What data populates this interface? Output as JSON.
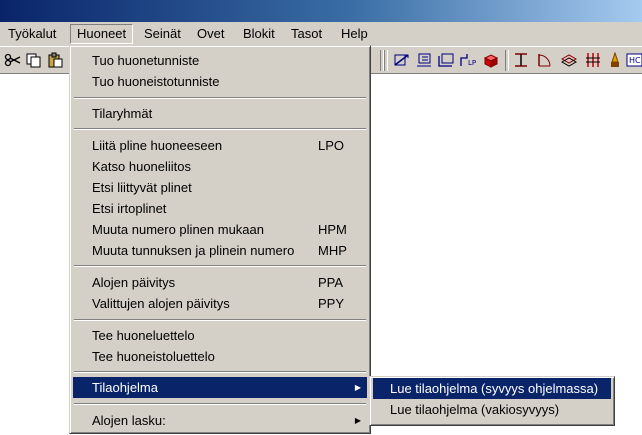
{
  "menubar": {
    "items": [
      "Työkalut",
      "Huoneet",
      "Seinät",
      "Ovet",
      "Blokit",
      "Tasot",
      "Help"
    ],
    "open_menu": "Huoneet"
  },
  "toolbar": {
    "left_icons": [
      "scissors-icon",
      "copy-icon",
      "paste-icon"
    ],
    "right_icons": [
      "dimension-icon",
      "room-tag-icon",
      "room-area-icon",
      "pline-icon",
      "3d-box-icon",
      "beam-icon",
      "door-icon",
      "layer-icon",
      "wall-hatch-icon",
      "pen-icon",
      "room-id-icon"
    ]
  },
  "colors": {
    "menu_bg": "#d4d0c8",
    "highlight": "#0a246a",
    "highlight_text": "#ffffff",
    "title_bar": "#0a246a"
  },
  "dropdown": {
    "items": [
      {
        "label": "Tuo huonetunniste",
        "shortcut": ""
      },
      {
        "label": "Tuo huoneistotunniste",
        "shortcut": ""
      },
      {
        "label": "Tilaryhmät",
        "shortcut": ""
      },
      {
        "label": "Liitä pline huoneeseen",
        "shortcut": "LPO"
      },
      {
        "label": "Katso huoneliitos",
        "shortcut": ""
      },
      {
        "label": "Etsi liittyvät plinet",
        "shortcut": ""
      },
      {
        "label": "Etsi irtoplinet",
        "shortcut": ""
      },
      {
        "label": "Muuta numero plinen mukaan",
        "shortcut": "HPM"
      },
      {
        "label": "Muuta tunnuksen ja plinein numero",
        "shortcut": "MHP"
      },
      {
        "label": "Alojen päivitys",
        "shortcut": "PPA"
      },
      {
        "label": "Valittujen alojen päivitys",
        "shortcut": "PPY"
      },
      {
        "label": "Tee huoneluettelo",
        "shortcut": ""
      },
      {
        "label": "Tee huoneistoluettelo",
        "shortcut": ""
      },
      {
        "label": "Tilaohjelma",
        "shortcut": ""
      },
      {
        "label": "Alojen lasku:",
        "shortcut": ""
      }
    ]
  },
  "submenu": {
    "items": [
      {
        "label": "Lue tilaohjelma (syvyys ohjelmassa)"
      },
      {
        "label": "Lue tilaohjelma (vakiosyvyys)"
      }
    ]
  }
}
